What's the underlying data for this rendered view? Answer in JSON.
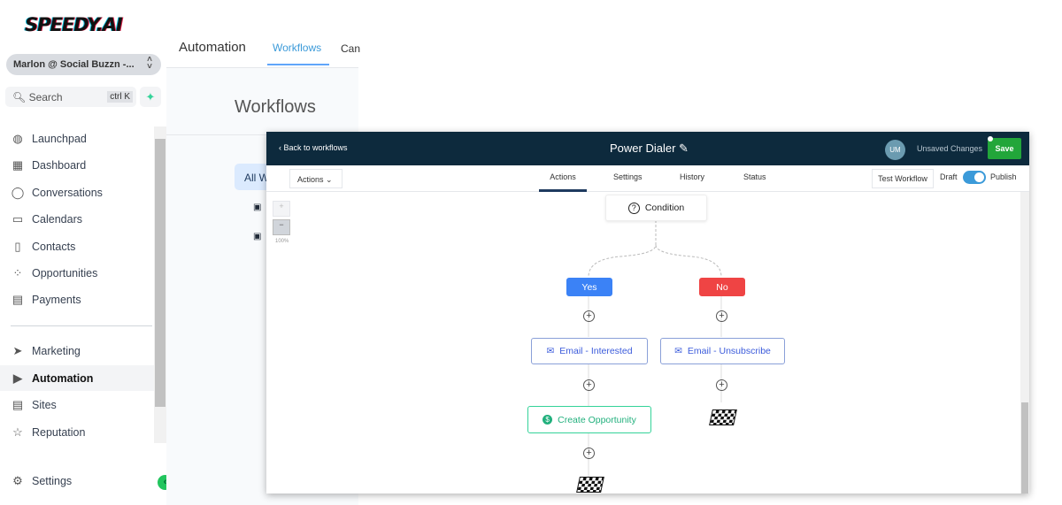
{
  "brand": {
    "logo_text": "SPEEDY.AI"
  },
  "sidebar": {
    "account": "Marlon @ Social Buzzn -...",
    "search_label": "Search",
    "search_shortcut": "ctrl K",
    "items": [
      {
        "label": "Launchpad",
        "icon": "rocket-icon"
      },
      {
        "label": "Dashboard",
        "icon": "grid-icon"
      },
      {
        "label": "Conversations",
        "icon": "chat-icon"
      },
      {
        "label": "Calendars",
        "icon": "calendar-icon"
      },
      {
        "label": "Contacts",
        "icon": "contacts-icon"
      },
      {
        "label": "Opportunities",
        "icon": "opportunities-icon"
      },
      {
        "label": "Payments",
        "icon": "payments-icon"
      },
      {
        "label": "Marketing",
        "icon": "send-icon"
      },
      {
        "label": "Automation",
        "icon": "automation-icon",
        "active": true
      },
      {
        "label": "Sites",
        "icon": "sites-icon"
      },
      {
        "label": "Reputation",
        "icon": "star-icon"
      },
      {
        "label": "Settings",
        "icon": "gear-icon"
      }
    ]
  },
  "background_page": {
    "title": "Automation",
    "tabs": [
      "Workflows",
      "Can"
    ],
    "heading": "Workflows",
    "filter_tab": "All W"
  },
  "modal": {
    "back_label": "Back to workflows",
    "title": "Power Dialer",
    "avatar_initials": "UM",
    "status": "Unsaved Changes",
    "save_label": "Save",
    "actions_dropdown": "Actions",
    "tabs": [
      "Actions",
      "Settings",
      "History",
      "Status"
    ],
    "active_tab": "Actions",
    "test_label": "Test Workflow",
    "draft_label": "Draft",
    "publish_label": "Publish",
    "zoom_level": "100%",
    "nodes": {
      "condition": "Condition",
      "yes": "Yes",
      "no": "No",
      "email_interested": "Email - Interested",
      "email_unsubscribe": "Email - Unsubscribe",
      "create_opportunity": "Create Opportunity"
    },
    "colors": {
      "header": "#0d2a3d",
      "save": "#22a63a",
      "yes": "#3b82f6",
      "no": "#ef4444",
      "opportunity": "#34d399"
    }
  }
}
